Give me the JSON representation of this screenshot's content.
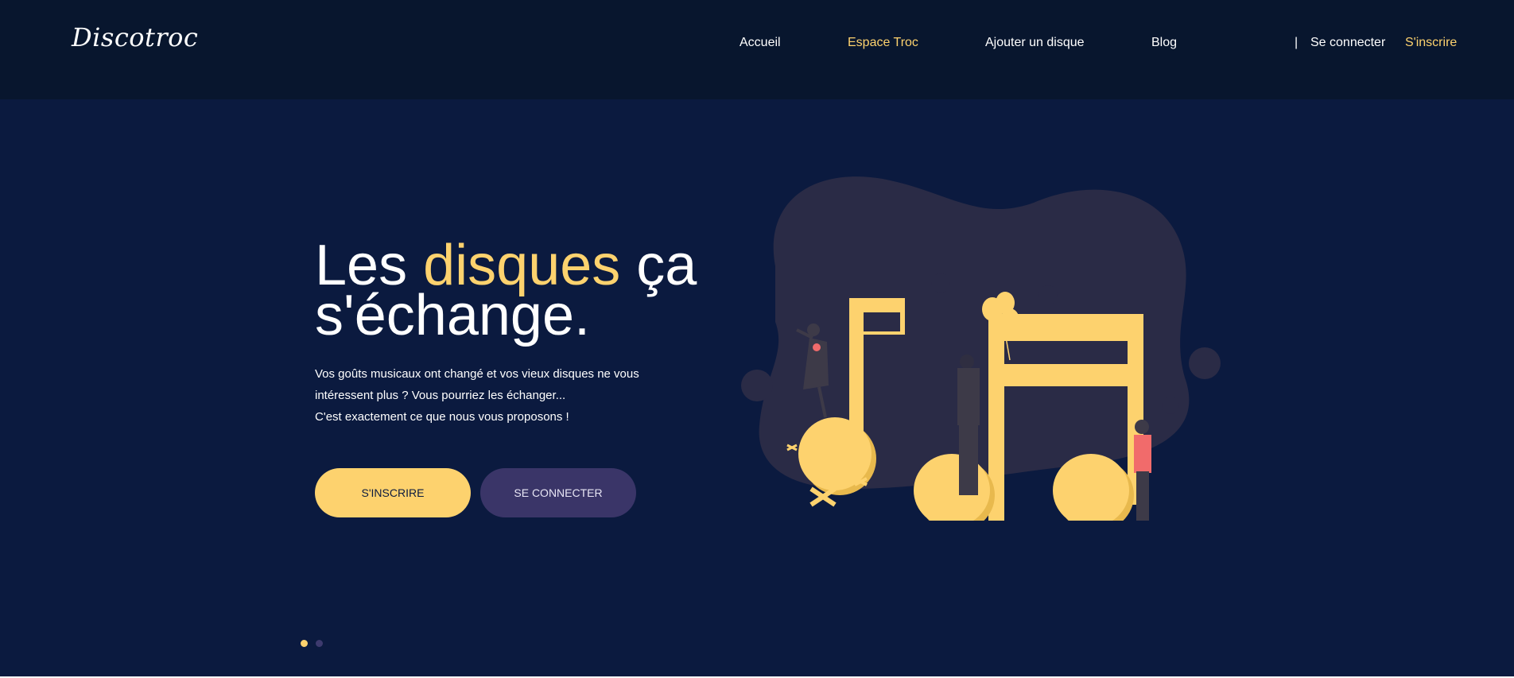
{
  "header": {
    "logo": "Discotroc",
    "nav": [
      {
        "label": "Accueil"
      },
      {
        "label": "Espace Troc"
      },
      {
        "label": "Ajouter un disque"
      },
      {
        "label": "Blog"
      }
    ],
    "separator": "|",
    "login": "Se connecter",
    "signup": "S'inscrire"
  },
  "hero": {
    "title_part1": "Les",
    "title_accent": "disques",
    "title_part2": "ça",
    "title_line2": "s'échange.",
    "desc_line1": "Vos goûts musicaux ont changé et vos vieux disques ne vous",
    "desc_line2": "intéressent plus ? Vous pourriez les échanger...",
    "desc_line3": "C'est exactement ce que nous vous proposons !",
    "btn_signup": "S'INSCRIRE",
    "btn_login": "SE CONNECTER"
  },
  "carousel": {
    "total": 2,
    "active": 1
  },
  "colors": {
    "header_bg": "#08162e",
    "hero_bg": "#0b1a3f",
    "accent": "#fdd26e",
    "secondary_button": "#3a3568",
    "illustration_blob": "#2a2b46",
    "figure_pink": "#f16b6b"
  }
}
